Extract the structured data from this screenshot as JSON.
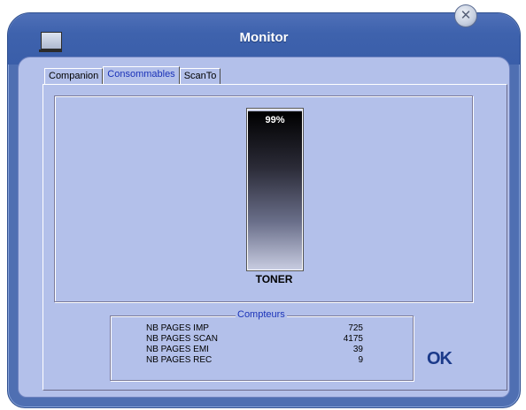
{
  "window": {
    "title": "Monitor",
    "icon": "monitor-icon",
    "close_icon": "close-icon"
  },
  "tabs": [
    {
      "label": "Companion",
      "active": false
    },
    {
      "label": "Consommables",
      "active": true
    },
    {
      "label": "ScanTo",
      "active": false
    }
  ],
  "toner": {
    "percent_label": "99%",
    "level": 0.99,
    "label": "TONER"
  },
  "counters": {
    "legend": "Compteurs",
    "rows": [
      {
        "label": "NB PAGES IMP",
        "value": "725"
      },
      {
        "label": "NB PAGES SCAN",
        "value": "4175"
      },
      {
        "label": "NB PAGES EMI",
        "value": "39"
      },
      {
        "label": "NB PAGES REC",
        "value": "9"
      }
    ]
  },
  "ok_label": "OK",
  "colors": {
    "frame": "#4f6fb2",
    "client": "#b3c0ea",
    "accent_text": "#1a32b8"
  }
}
